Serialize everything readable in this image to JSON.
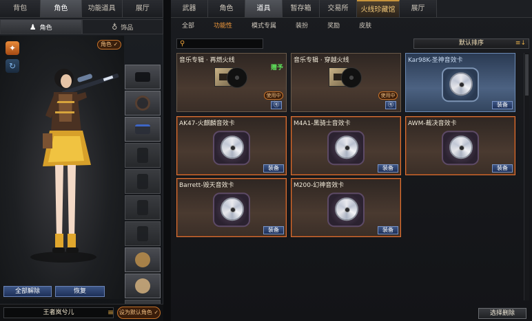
{
  "left_panel": {
    "tabs": [
      {
        "label": "背包"
      },
      {
        "label": "角色"
      },
      {
        "label": "功能道具"
      },
      {
        "label": "展厅"
      }
    ],
    "active_tab": 1,
    "subtabs": [
      {
        "label": "角色",
        "icon": "character-icon"
      },
      {
        "label": "饰品",
        "icon": "accessory-icon"
      }
    ],
    "active_subtab": 0,
    "role_badge": "角色 ✓",
    "clear_all_label": "全部解除",
    "restore_label": "恢复",
    "character_name": "王者岚兮儿",
    "set_default_label": "设为默认角色 ✓"
  },
  "right_panel": {
    "tabs": [
      {
        "label": "武器"
      },
      {
        "label": "角色"
      },
      {
        "label": "道具"
      },
      {
        "label": "暂存箱"
      },
      {
        "label": "交易所"
      },
      {
        "label": "火线珍藏馆"
      },
      {
        "label": "展厅"
      }
    ],
    "active_tab": 2,
    "featured_tab": 5,
    "subtabs": [
      "全部",
      "功能性",
      "模式专属",
      "装扮",
      "奖励",
      "皮肤"
    ],
    "active_subtab": 1,
    "search": {
      "placeholder": "",
      "value": ""
    },
    "sort_label": "默认排序",
    "items": [
      {
        "title": "音乐专辑 · 再燃火线",
        "type": "album",
        "gift": "赠予",
        "in_use": "使用中✓",
        "button": "ⓠ"
      },
      {
        "title": "音乐专辑 · 穿越火线",
        "type": "album",
        "gift": "",
        "in_use": "使用中✓",
        "button": "ⓠ"
      },
      {
        "title": "Kar98K-圣神音效卡",
        "type": "disc",
        "style": "blue",
        "button": "装备"
      },
      {
        "title": "AK47-火麒麟音效卡",
        "type": "disc",
        "style": "sel",
        "button": "装备"
      },
      {
        "title": "M4A1-黑骑士音效卡",
        "type": "disc",
        "style": "sel",
        "button": "装备"
      },
      {
        "title": "AWM-裁决音效卡",
        "type": "disc",
        "style": "sel",
        "button": "装备"
      },
      {
        "title": "Barrett-毁天音效卡",
        "type": "disc",
        "style": "sel",
        "button": "装备"
      },
      {
        "title": "M200-幻神音效卡",
        "type": "disc",
        "style": "sel",
        "button": "装备"
      }
    ],
    "select_delete_label": "选择删除"
  }
}
